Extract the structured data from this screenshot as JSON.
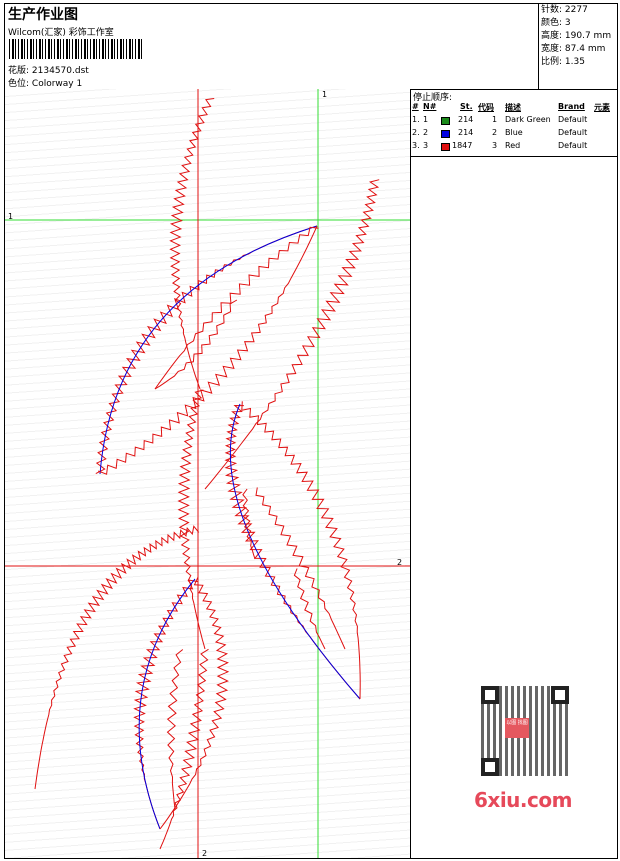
{
  "header": {
    "title": "生产作业图",
    "company": "Wilcom(汇家) 彩饰工作室",
    "file_label": "花版:",
    "file_value": "2134570.dst",
    "colorway_label": "色位:",
    "colorway_value": "Colorway 1"
  },
  "stats": [
    {
      "label": "针数:",
      "value": "2277"
    },
    {
      "label": "颜色:",
      "value": "3"
    },
    {
      "label": "高度:",
      "value": "190.7 mm"
    },
    {
      "label": "宽度:",
      "value": "87.4 mm"
    },
    {
      "label": "比例:",
      "value": "1.35"
    }
  ],
  "crosshairs": {
    "green_v": "1",
    "green_h": "1",
    "red_h": "2",
    "red_v": "2"
  },
  "stop_sequence": {
    "title": "停止顺序:",
    "headers": {
      "num": "#",
      "no": "N#",
      "st": "St.",
      "code": "代码",
      "desc": "描述",
      "brand": "Brand",
      "elem": "元素"
    },
    "rows": [
      {
        "num": "1.",
        "no": "1",
        "color": "#1a8a1a",
        "st": "214",
        "code": "1",
        "desc": "Dark Green",
        "brand": "Default"
      },
      {
        "num": "2.",
        "no": "2",
        "color": "#0000e0",
        "st": "214",
        "code": "2",
        "desc": "Blue",
        "brand": "Default"
      },
      {
        "num": "3.",
        "no": "3",
        "color": "#e01010",
        "st": "1847",
        "code": "3",
        "desc": "Red",
        "brand": "Default"
      }
    ]
  },
  "watermark": {
    "text": "6xiu.com",
    "qr_center": "以图\n找图"
  }
}
